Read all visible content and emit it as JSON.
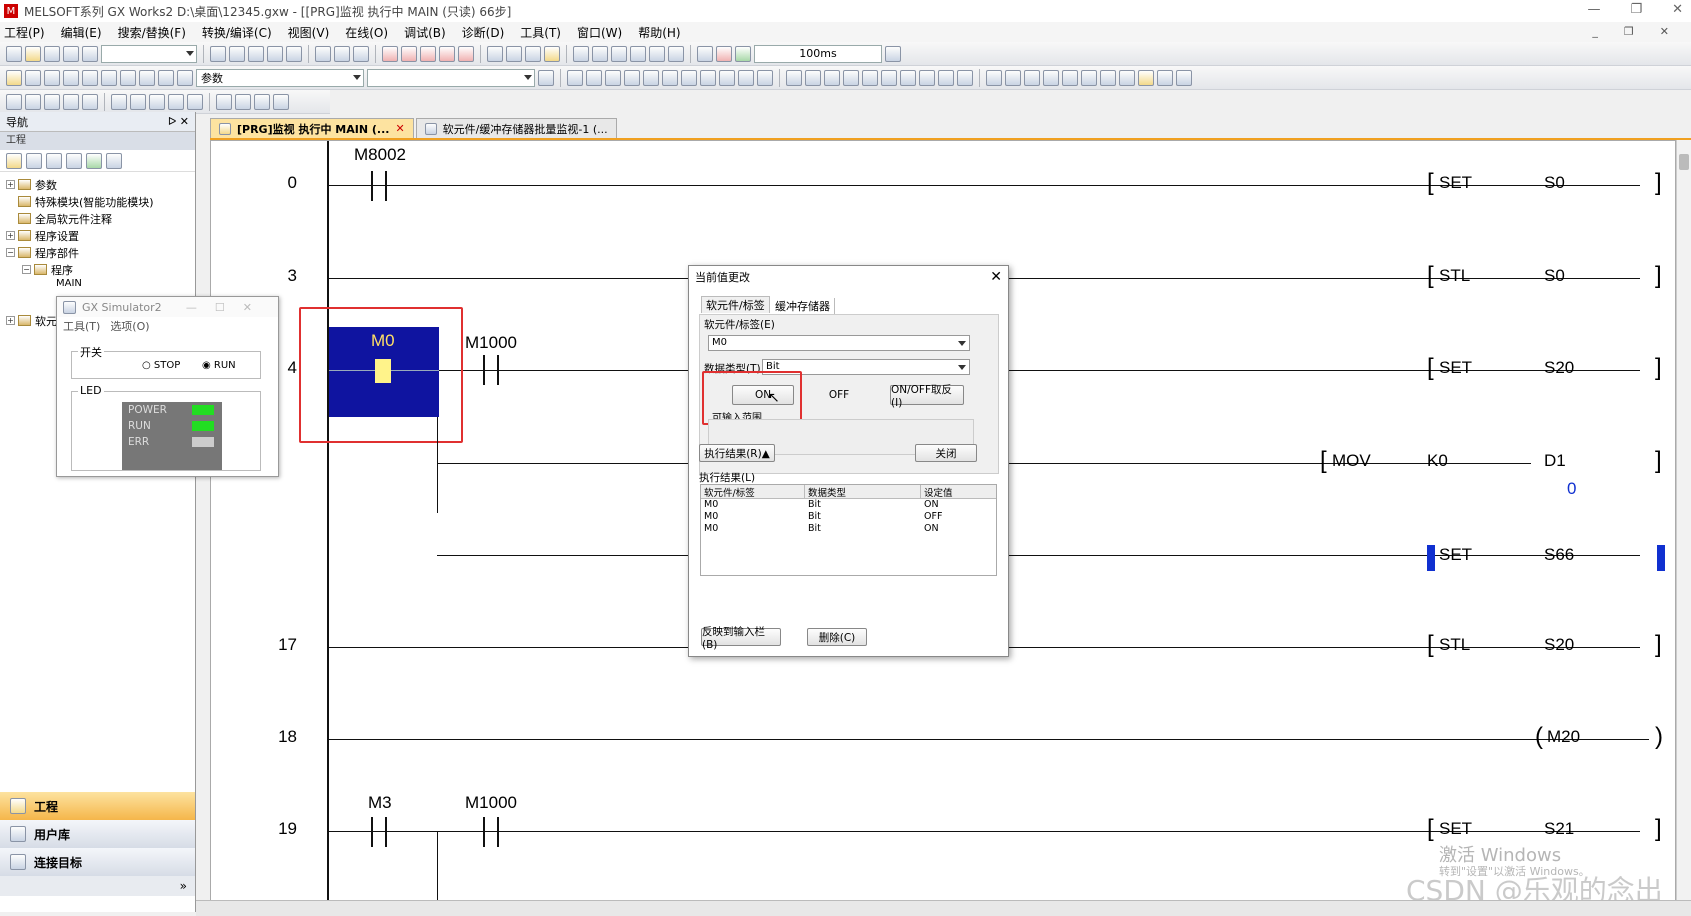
{
  "window": {
    "title": "MELSOFT系列 GX Works2 D:\\桌面\\12345.gxw - [[PRG]监视 执行中 MAIN (只读) 66步]"
  },
  "menu": [
    "工程(P)",
    "编辑(E)",
    "搜索/替换(F)",
    "转换/编译(C)",
    "视图(V)",
    "在线(O)",
    "调试(B)",
    "诊断(D)",
    "工具(T)",
    "窗口(W)",
    "帮助(H)"
  ],
  "toolbar": {
    "scan_time": "100ms",
    "param_combo": "参数"
  },
  "nav": {
    "title": "导航",
    "sub": "工程",
    "tree": [
      "参数",
      "特殊模块(智能功能模块)",
      "全局软元件注释",
      "程序设置",
      "程序部件",
      "程序",
      "MAIN",
      "软元"
    ],
    "bottom": [
      "工程",
      "用户库",
      "连接目标"
    ]
  },
  "tabs": [
    {
      "label": "[PRG]监视 执行中 MAIN (...",
      "active": true
    },
    {
      "label": "软元件/缓冲存储器批量监视-1 (...",
      "active": false
    }
  ],
  "ladder": {
    "rungs": [
      {
        "step": "0",
        "contacts": [
          "M8002"
        ],
        "instr": [
          "SET",
          "S0"
        ]
      },
      {
        "step": "3",
        "contacts": [],
        "instr": [
          "STL",
          "S0"
        ]
      },
      {
        "step": "4",
        "contacts": [
          "M0",
          "M1000"
        ],
        "instr": [
          "SET",
          "S20"
        ]
      },
      {
        "step": "",
        "contacts": [],
        "instr": [
          "MOV",
          "K0",
          "D1"
        ],
        "value": "0"
      },
      {
        "step": "",
        "contacts": [],
        "instr": [
          "SET",
          "S66"
        ]
      },
      {
        "step": "17",
        "contacts": [],
        "instr": [
          "STL",
          "S20"
        ]
      },
      {
        "step": "18",
        "contacts": [],
        "instr": [
          "M20"
        ]
      },
      {
        "step": "19",
        "contacts": [
          "M3",
          "M1000"
        ],
        "instr": [
          "SET",
          "S21"
        ]
      }
    ]
  },
  "simulator": {
    "title": "GX Simulator2",
    "menu": [
      "工具(T)",
      "选项(O)"
    ],
    "switch_label": "开关",
    "stop": "STOP",
    "run": "RUN",
    "led_label": "LED",
    "leds": [
      {
        "name": "POWER",
        "color": "#22dd22"
      },
      {
        "name": "RUN",
        "color": "#22dd22"
      },
      {
        "name": "ERR",
        "color": "#cccccc"
      }
    ]
  },
  "dialog": {
    "title": "当前值更改",
    "tab1": "软元件/标签",
    "tab2": "缓冲存储器",
    "device_label": "软元件/标签(E)",
    "device_value": "M0",
    "type_label": "数据类型(T)",
    "type_value": "Bit",
    "on": "ON",
    "off": "OFF",
    "toggle": "ON/OFF取反(I)",
    "range_label": "可输入范围",
    "exec_btn": "执行结果(R)▲",
    "close_btn": "关闭",
    "result_label": "执行结果(L)",
    "cols": [
      "软元件/标签",
      "数据类型",
      "设定值"
    ],
    "rows": [
      [
        "M0",
        "Bit",
        "ON"
      ],
      [
        "M0",
        "Bit",
        "OFF"
      ],
      [
        "M0",
        "Bit",
        "ON"
      ]
    ],
    "reflect_btn": "反映到输入栏(B)",
    "delete_btn": "删除(C)"
  },
  "watermark": {
    "activate": "激活 Windows",
    "hint": "转到\"设置\"以激活 Windows。",
    "csdn": "CSDN @乐观的念出"
  }
}
